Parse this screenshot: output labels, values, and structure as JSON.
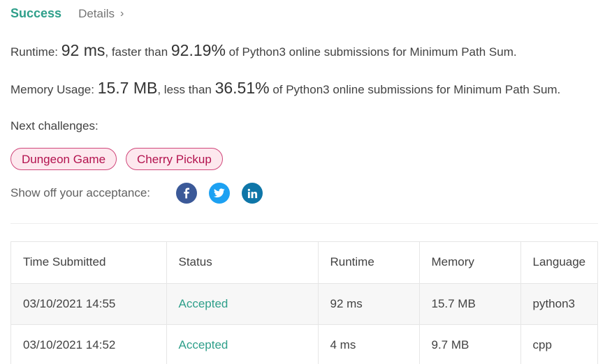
{
  "header": {
    "success_label": "Success",
    "details_label": "Details"
  },
  "runtime_line": {
    "prefix": "Runtime: ",
    "value": "92 ms",
    "mid": ", faster than ",
    "percent": "92.19%",
    "suffix": " of Python3 online submissions for Minimum Path Sum."
  },
  "memory_line": {
    "prefix": "Memory Usage: ",
    "value": "15.7 MB",
    "mid": ", less than ",
    "percent": "36.51%",
    "suffix": " of Python3 online submissions for Minimum Path Sum."
  },
  "next_challenges": {
    "label": "Next challenges:",
    "items": [
      "Dungeon Game",
      "Cherry Pickup"
    ]
  },
  "share": {
    "label": "Show off your acceptance:",
    "icons": [
      "facebook-icon",
      "twitter-icon",
      "linkedin-icon"
    ]
  },
  "colors": {
    "accent": "#2e9f8a",
    "chip_border": "#d0467a",
    "chip_bg": "#fde8ee",
    "facebook": "#3b5998",
    "twitter": "#1da1f2",
    "linkedin": "#0e76a8"
  },
  "submissions": {
    "headers": [
      "Time Submitted",
      "Status",
      "Runtime",
      "Memory",
      "Language"
    ],
    "rows": [
      [
        "03/10/2021 14:55",
        "Accepted",
        "92 ms",
        "15.7 MB",
        "python3"
      ],
      [
        "03/10/2021 14:52",
        "Accepted",
        "4 ms",
        "9.7 MB",
        "cpp"
      ]
    ]
  }
}
